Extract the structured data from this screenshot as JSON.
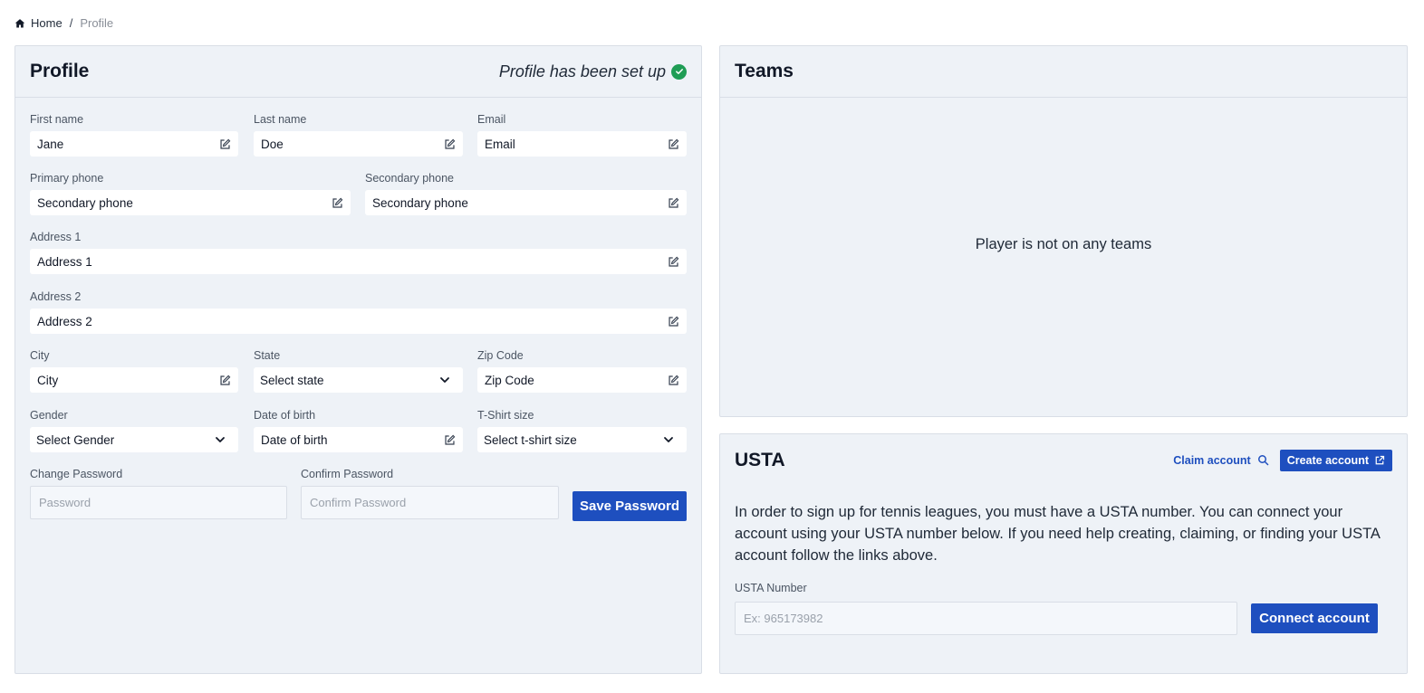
{
  "breadcrumb": {
    "home": "Home",
    "separator": "/",
    "current": "Profile"
  },
  "profile": {
    "title": "Profile",
    "status": "Profile has been set up",
    "fields": {
      "first_name": {
        "label": "First name",
        "value": "Jane"
      },
      "last_name": {
        "label": "Last name",
        "value": "Doe"
      },
      "email": {
        "label": "Email",
        "value": "Email"
      },
      "primary_phone": {
        "label": "Primary phone",
        "value": "Secondary phone"
      },
      "secondary_phone": {
        "label": "Secondary phone",
        "value": "Secondary phone"
      },
      "address1": {
        "label": "Address 1",
        "value": "Address 1"
      },
      "address2": {
        "label": "Address 2",
        "value": "Address 2"
      },
      "city": {
        "label": "City",
        "value": "City"
      },
      "state": {
        "label": "State",
        "value": "Select state"
      },
      "zip": {
        "label": "Zip Code",
        "value": "Zip Code"
      },
      "gender": {
        "label": "Gender",
        "value": "Select Gender"
      },
      "dob": {
        "label": "Date of birth",
        "value": "Date of birth"
      },
      "tshirt": {
        "label": "T-Shirt size",
        "value": "Select t-shirt size"
      },
      "change_password": {
        "label": "Change Password",
        "placeholder": "Password"
      },
      "confirm_password": {
        "label": "Confirm Password",
        "placeholder": "Confirm Password"
      }
    },
    "save_password_label": "Save Password"
  },
  "teams": {
    "title": "Teams",
    "empty_message": "Player is not on any teams"
  },
  "usta": {
    "title": "USTA",
    "claim_label": "Claim account",
    "create_label": "Create account",
    "description": "In order to sign up for tennis leagues, you must have a USTA number. You can connect your account using your USTA number below. If you need help creating, claiming, or finding your USTA account follow the links above.",
    "number_label": "USTA Number",
    "number_placeholder": "Ex: 965173982",
    "connect_label": "Connect account"
  },
  "colors": {
    "primary": "#1e4fbf",
    "success": "#1f9d55",
    "card_bg": "#eef2f7"
  }
}
